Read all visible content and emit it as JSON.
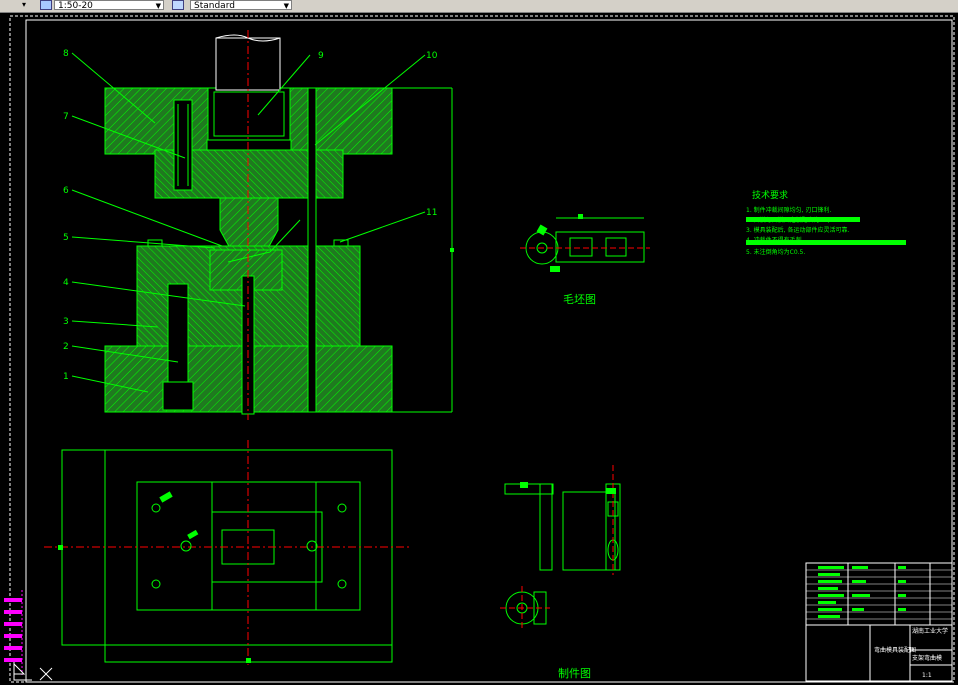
{
  "toolbar": {
    "scale_combo": "1:50-20",
    "style_combo": "Standard",
    "left_arrow": "▾"
  },
  "part_labels": [
    "1",
    "2",
    "3",
    "4",
    "5",
    "6",
    "7",
    "8",
    "9",
    "10",
    "11"
  ],
  "captions": {
    "blank": "毛坯图",
    "part": "制件图"
  },
  "tech_notes": {
    "title": "技术要求",
    "lines": [
      "1. 制件冲裁间隙均匀, 刃口锋利.",
      "2. 凸模与凸模固定板配合为H7/m6.",
      "3. 模具装配后, 各运动部件应灵活可靠.",
      "4. 冲裁件不得有毛刺.",
      "5. 未注倒角均为C0.5."
    ]
  },
  "title_block": {
    "school": "湖南工业大学",
    "drawing_name": "弯曲模具装配图",
    "product": "支架弯曲模",
    "scale": "1:1"
  },
  "ucs": {
    "x": "X",
    "y": "Y"
  }
}
